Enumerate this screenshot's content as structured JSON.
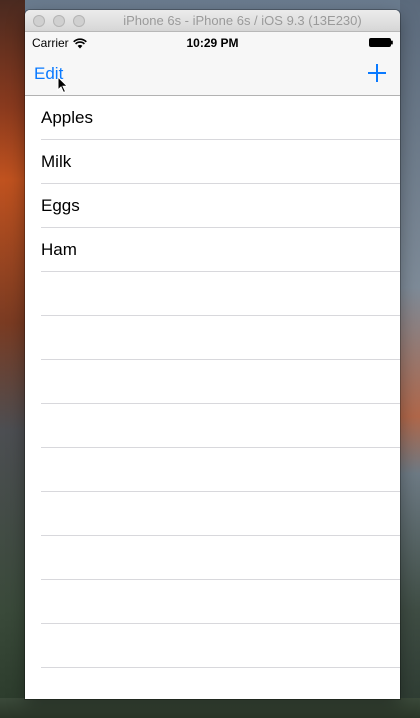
{
  "window": {
    "title": "iPhone 6s - iPhone 6s / iOS 9.3 (13E230)"
  },
  "statusbar": {
    "carrier": "Carrier",
    "wifi_icon": "wifi-icon",
    "time": "10:29 PM",
    "battery_icon": "battery-full-icon"
  },
  "navbar": {
    "edit_label": "Edit",
    "add_icon": "plus-icon"
  },
  "colors": {
    "accent": "#0a7aff",
    "separator": "#d8d8dc",
    "bar_background": "#f7f7f7"
  },
  "list": {
    "items": [
      "Apples",
      "Milk",
      "Eggs",
      "Ham"
    ],
    "empty_rows": 10
  }
}
